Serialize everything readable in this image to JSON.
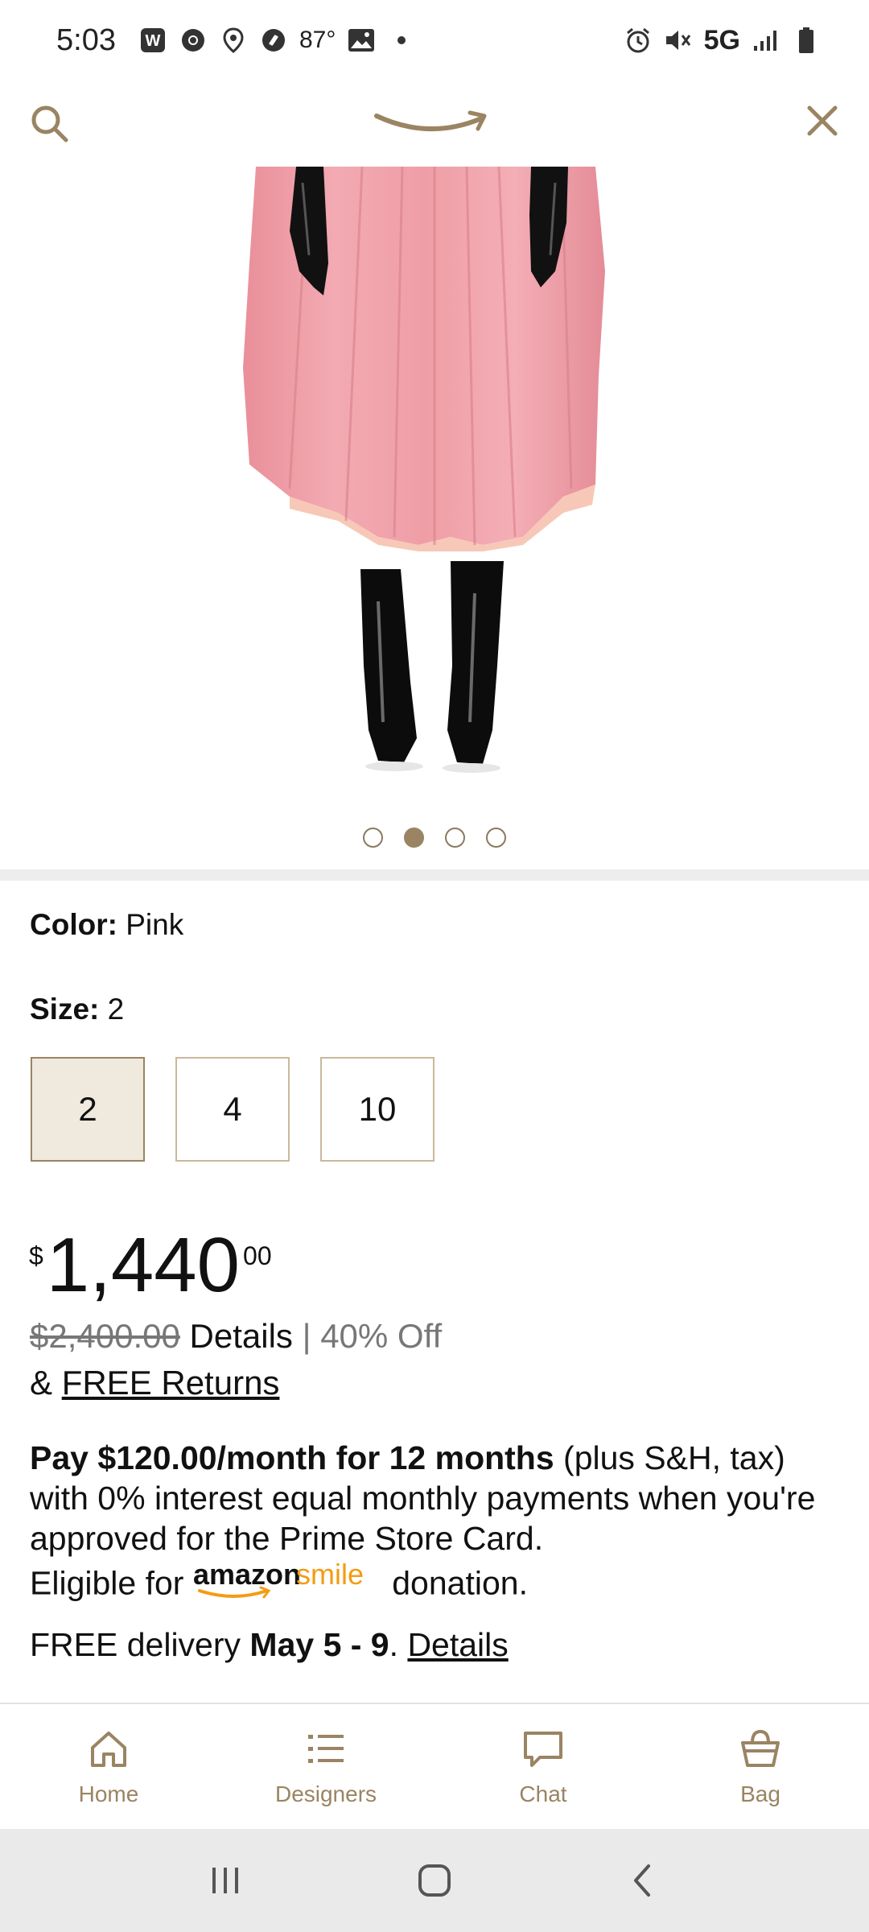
{
  "status_bar": {
    "time": "5:03",
    "temperature": "87°",
    "network": "5G",
    "left_icons": [
      "w-app-icon",
      "chrome-icon",
      "maps-pin-icon",
      "shazam-icon",
      "image-icon"
    ],
    "right_icons": [
      "alarm-icon",
      "mute-icon",
      "signal-icon",
      "battery-icon"
    ]
  },
  "header": {
    "search_icon": "search-icon",
    "logo": "amazon-smile-logo",
    "close_icon": "close-icon"
  },
  "colors": {
    "accent": "#9a8462",
    "selected_bg": "#efe9de",
    "garment": "#f0a5ad",
    "text": "#111111",
    "muted": "#777777"
  },
  "carousel": {
    "total": 4,
    "active_index": 1
  },
  "product": {
    "color_label": "Color:",
    "color_value": "Pink",
    "size_label": "Size:",
    "size_value": "2",
    "sizes": [
      "2",
      "4",
      "10"
    ],
    "selected_size_index": 0,
    "price": {
      "currency": "$",
      "whole": "1,440",
      "cents": "00"
    },
    "list_price": "$2,400.00",
    "details_label": "Details",
    "separator": "|",
    "discount": "40% Off",
    "returns_prefix": "&",
    "returns_link": "FREE Returns",
    "financing": {
      "bold": "Pay $120.00/month for 12 months",
      "text": " (plus S&H, tax) with 0% interest equal monthly payments when you're approved for the Prime Store Card.",
      "eligible_prefix": "Eligible for",
      "smile_logo_text_1": "amazon",
      "smile_logo_text_2": "smile",
      "eligible_suffix": "donation."
    },
    "delivery": {
      "prefix": "FREE delivery",
      "dates": "May 5 - 9",
      "punct": ".",
      "details_link": "Details"
    }
  },
  "bottom_nav": [
    {
      "label": "Home",
      "icon": "home-icon"
    },
    {
      "label": "Designers",
      "icon": "list-icon"
    },
    {
      "label": "Chat",
      "icon": "chat-icon"
    },
    {
      "label": "Bag",
      "icon": "bag-icon"
    }
  ],
  "system_nav": [
    "recents-icon",
    "home-button-icon",
    "back-icon"
  ]
}
